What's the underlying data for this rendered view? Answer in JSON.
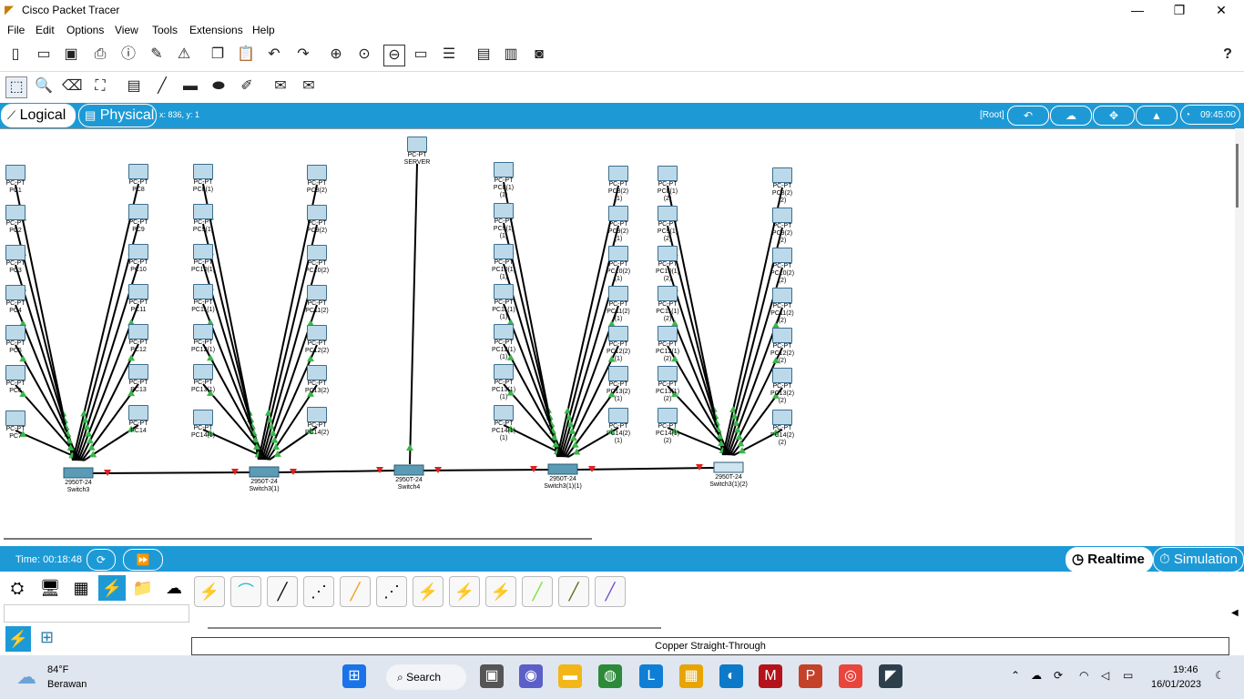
{
  "window": {
    "title": "Cisco Packet Tracer",
    "minimize": "—",
    "maximize": "❐",
    "close": "✕"
  },
  "menu": [
    "File",
    "Edit",
    "Options",
    "View",
    "Tools",
    "Extensions",
    "Help"
  ],
  "toolbar": {
    "help": "?"
  },
  "tabs": {
    "logical": "Logical",
    "physical": "Physical",
    "coords": "x: 836, y: 1",
    "root": "[Root]",
    "clock": "09:45:00"
  },
  "network": {
    "pc_type": "PC-PT",
    "server_type": "PC-PT",
    "server_name": "SERVER",
    "switch_model": "2950T-24",
    "switches": [
      {
        "name": "Switch3"
      },
      {
        "name": "Switch3(1)"
      },
      {
        "name": "Switch4"
      },
      {
        "name": "Switch3(1)(1)"
      },
      {
        "name": "Switch3(1)(2)"
      }
    ],
    "groups": [
      [
        "PC1",
        "PC2",
        "PC3",
        "PC4",
        "PC5",
        "PC6",
        "PC7"
      ],
      [
        "PC8",
        "PC9",
        "PC10",
        "PC11",
        "PC12",
        "PC13",
        "PC14"
      ],
      [
        "PC8(1)",
        "PC9(1)",
        "PC10(1)",
        "PC11(1)",
        "PC12(1)",
        "PC13(1)",
        "PC14(1)"
      ],
      [
        "PC8(2)",
        "PC9(2)",
        "PC10(2)",
        "PC11(2)",
        "PC12(2)",
        "PC13(2)",
        "PC14(2)"
      ],
      [
        "PC8(1)(1)",
        "PC9(1)(1)",
        "PC10(1)(1)",
        "PC11(1)(1)",
        "PC12(1)(1)",
        "PC13(1)(1)",
        "PC14(1)(1)"
      ],
      [
        "PC8(2)(1)",
        "PC9(2)(1)",
        "PC10(2)(1)",
        "PC11(2)(1)",
        "PC12(2)(1)",
        "PC13(2)(1)",
        "PC14(2)(1)"
      ],
      [
        "PC8(1)(2)",
        "PC9(1)(2)",
        "PC10(1)(2)",
        "PC11(1)(2)",
        "PC12(1)(2)",
        "PC13(1)(2)",
        "PC14(1)(2)"
      ],
      [
        "PC8(2)(2)",
        "PC9(2)(2)",
        "PC10(2)(2)",
        "PC11(2)(2)",
        "PC12(2)(2)",
        "PC13(2)(2)",
        "PC14(2)(2)"
      ]
    ]
  },
  "bottom": {
    "time": "Time: 00:18:48",
    "realtime": "Realtime",
    "simulation": "Simulation",
    "connection_label": "Copper Straight-Through"
  },
  "taskbar": {
    "temp": "84°F",
    "weather": "Berawan",
    "search": "Search",
    "time": "19:46",
    "date": "16/01/2023"
  },
  "colors": {
    "accent": "#1d9ad6",
    "link_up": "#39b54a",
    "link_down": "#e02020"
  }
}
